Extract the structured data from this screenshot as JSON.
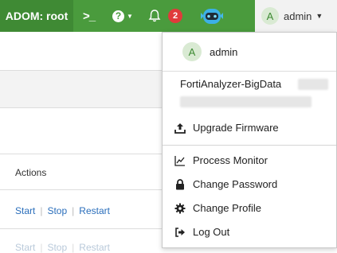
{
  "topbar": {
    "adom_label": "ADOM: root",
    "cli_icon": "terminal-icon",
    "help_icon": "question-circle-icon",
    "notification_count": "2",
    "user_initial": "A",
    "user_name": "admin"
  },
  "page": {
    "actions_header": "Actions",
    "rows": [
      {
        "start": "Start",
        "stop": "Stop",
        "restart": "Restart"
      },
      {
        "start": "Start",
        "stop": "Stop",
        "restart": "Restart"
      }
    ]
  },
  "menu": {
    "user_initial": "A",
    "user_name": "admin",
    "device_name": "FortiAnalyzer-BigData",
    "items": [
      {
        "label": "Upgrade Firmware",
        "icon": "upload-icon"
      },
      {
        "label": "Process Monitor",
        "icon": "chart-line-icon"
      },
      {
        "label": "Change Password",
        "icon": "lock-icon"
      },
      {
        "label": "Change Profile",
        "icon": "gear-icon"
      },
      {
        "label": "Log Out",
        "icon": "sign-out-icon"
      }
    ]
  },
  "colors": {
    "topbar": "#4a9b3d",
    "badge": "#e03b3b",
    "link": "#2a6ebb"
  }
}
